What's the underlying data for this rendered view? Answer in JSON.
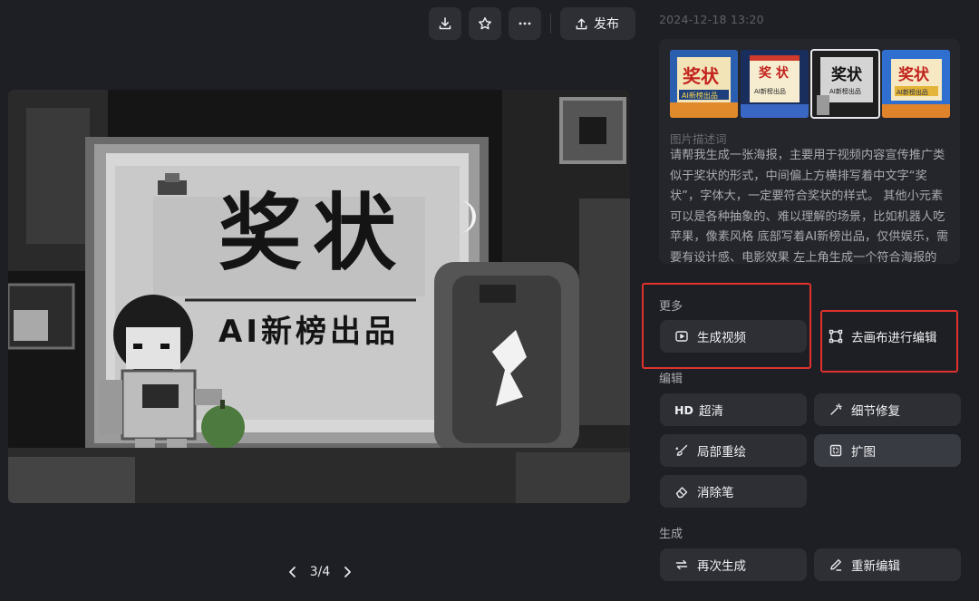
{
  "toolbar": {
    "download_icon": "download-icon",
    "favorite_icon": "star-icon",
    "more_icon": "more-icon",
    "publish_label": "发布"
  },
  "main_image": {
    "title_text": "奖状",
    "subtitle_text": "AI新榜出品"
  },
  "pager": {
    "current": "3/4"
  },
  "timestamp": "2024-12-18 13:20",
  "thumbnails": [
    {
      "title": "奖状",
      "subtitle": "AI新榜出品"
    },
    {
      "title": "奖 状",
      "subtitle": "AI新榜出品"
    },
    {
      "title": "奖状",
      "subtitle": "AI新榜出品",
      "selected": true
    },
    {
      "title": "奖状",
      "subtitle": "AI新榜出品"
    }
  ],
  "description": {
    "label": "图片描述词",
    "text": "请帮我生成一张海报，主要用于视频内容宣传推广类似于奖状的形式，中间偏上方横排写着中文字“奖状”，字体大，一定要符合奖状的样式。 其他小元素可以是各种抽象的、难以理解的场景，比如机器人吃苹果，像素风格 底部写着AI新榜出品，仅供娱乐，需要有设计感、电影效果 左上角生成一个符合海报的"
  },
  "sections": {
    "more": {
      "title": "更多",
      "generate_video": "生成视频",
      "canvas_edit": "去画布进行编辑"
    },
    "edit": {
      "title": "编辑",
      "hd_badge": "HD",
      "upscale": "超清",
      "detail_fix": "细节修复",
      "inpaint": "局部重绘",
      "outpaint": "扩图",
      "eraser": "消除笔"
    },
    "generate": {
      "title": "生成",
      "regenerate": "再次生成",
      "reedit": "重新编辑"
    }
  },
  "colors": {
    "background": "#1e1f24",
    "button": "#2d2f35",
    "highlight": "#e0312d"
  }
}
